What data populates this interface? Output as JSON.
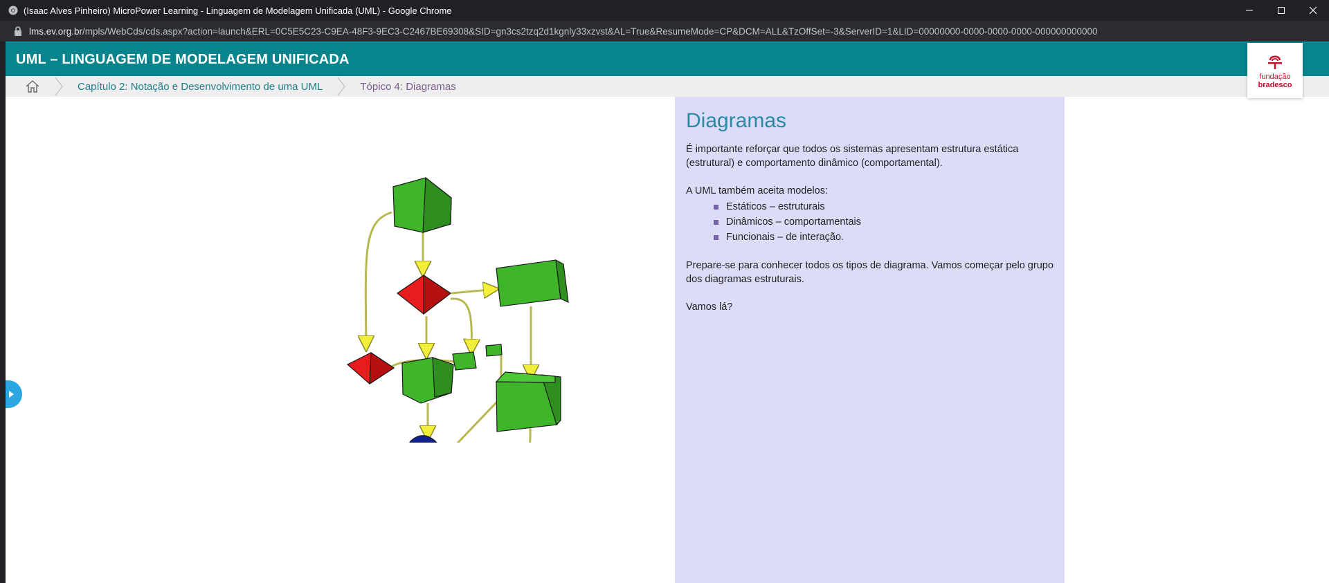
{
  "browser": {
    "window_title": "(Isaac Alves Pinheiro) MicroPower Learning - Linguagem de Modelagem Unificada (UML) - Google Chrome",
    "url_domain": "lms.ev.org.br",
    "url_path": "/mpls/WebCds/cds.aspx?action=launch&ERL=0C5E5C23-C9EA-48F3-9EC3-C2467BE69308&SID=gn3cs2tzq2d1kgnly33xzvst&AL=True&ResumeMode=CP&DCM=ALL&TzOffSet=-3&ServerID=1&LID=00000000-0000-0000-0000-000000000000"
  },
  "header": {
    "course_title": "UML – LINGUAGEM DE MODELAGEM UNIFICADA",
    "logo_line1": "fundação",
    "logo_line2": "bradesco"
  },
  "breadcrumb": {
    "chapter": "Capítulo 2: Notação e Desenvolvimento de uma UML",
    "topic": "Tópico 4: Diagramas"
  },
  "content": {
    "title": "Diagramas",
    "intro": "É importante reforçar que todos os sistemas apresentam estrutura estática (estrutural) e comportamento dinâmico (comportamental).",
    "models_intro": "A UML também aceita modelos:",
    "models": [
      "Estáticos – estruturais",
      "Dinâmicos – comportamentais",
      "Funcionais – de interação."
    ],
    "prepare": "Prepare-se para conhecer todos os tipos de diagrama. Vamos começar pelo grupo dos diagramas estruturais.",
    "closing": "Vamos lá?"
  },
  "colors": {
    "header_teal": "#07848c",
    "panel_lavender": "#dcdcf8",
    "title_blue": "#2a8aa5",
    "brand_red": "#c8102e"
  }
}
